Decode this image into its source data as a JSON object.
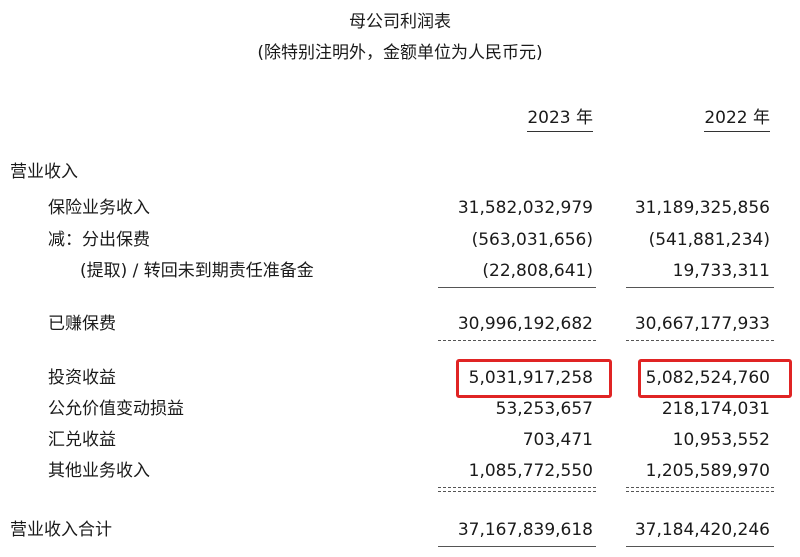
{
  "header": {
    "title": "母公司利润表",
    "subtitle": "(除特别注明外，金额单位为人民币元)"
  },
  "columns": [
    "2023 年",
    "2022 年"
  ],
  "rows": [
    {
      "label": "营业收入",
      "v2023": "",
      "v2022": ""
    },
    {
      "label": "保险业务收入",
      "v2023": "31,582,032,979",
      "v2022": "31,189,325,856"
    },
    {
      "label": "减：分出保费",
      "v2023": "(563,031,656)",
      "v2022": "(541,881,234)"
    },
    {
      "label": "(提取) / 转回未到期责任准备金",
      "v2023": "(22,808,641)",
      "v2022": "19,733,311"
    },
    {
      "label": "已赚保费",
      "v2023": "30,996,192,682",
      "v2022": "30,667,177,933"
    },
    {
      "label": "投资收益",
      "v2023": "5,031,917,258",
      "v2022": "5,082,524,760"
    },
    {
      "label": "公允价值变动损益",
      "v2023": "53,253,657",
      "v2022": "218,174,031"
    },
    {
      "label": "汇兑收益",
      "v2023": "703,471",
      "v2022": "10,953,552"
    },
    {
      "label": "其他业务收入",
      "v2023": "1,085,772,550",
      "v2022": "1,205,589,970"
    },
    {
      "label": "营业收入合计",
      "v2023": "37,167,839,618",
      "v2022": "37,184,420,246"
    }
  ],
  "highlight_color": "#e02424"
}
